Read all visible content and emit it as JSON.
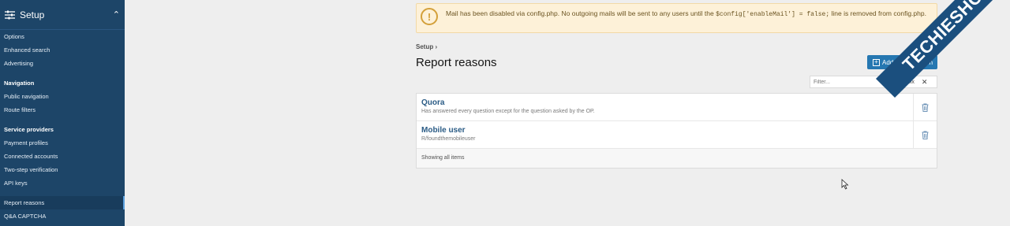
{
  "sidebar": {
    "title": "Setup",
    "groups": [
      {
        "items": [
          "Options",
          "Enhanced search",
          "Advertising"
        ]
      },
      {
        "section": "Navigation",
        "items": [
          "Public navigation",
          "Route filters"
        ]
      },
      {
        "section": "Service providers",
        "items": [
          "Payment profiles",
          "Connected accounts",
          "Two-step verification",
          "API keys"
        ]
      },
      {
        "items": [
          "Report reasons",
          "Q&A CAPTCHA"
        ]
      }
    ]
  },
  "notice": {
    "text_before": "Mail has been disabled via config.php. No outgoing mails will be sent to any users until the ",
    "code": "$config['enableMail'] = false;",
    "text_after": " line is removed from config.php."
  },
  "breadcrumb": "Setup",
  "breadcrumb_sep": "›",
  "page_title": "Report reasons",
  "add_button": "Add report reason",
  "filter": {
    "placeholder": "Filter...",
    "prefix_label": "Prefix",
    "clear": "✕"
  },
  "reasons": [
    {
      "title": "Quora",
      "description": "Has answered every question except for the question asked by the OP."
    },
    {
      "title": "Mobile user",
      "description": "R/foundthemobileuser"
    }
  ],
  "footer": "Showing all items",
  "watermark": "TECHIESHOME.COM",
  "colors": {
    "sidebar": "#1d4568",
    "accent": "#2577b1",
    "notice": "#fdf1d8"
  }
}
